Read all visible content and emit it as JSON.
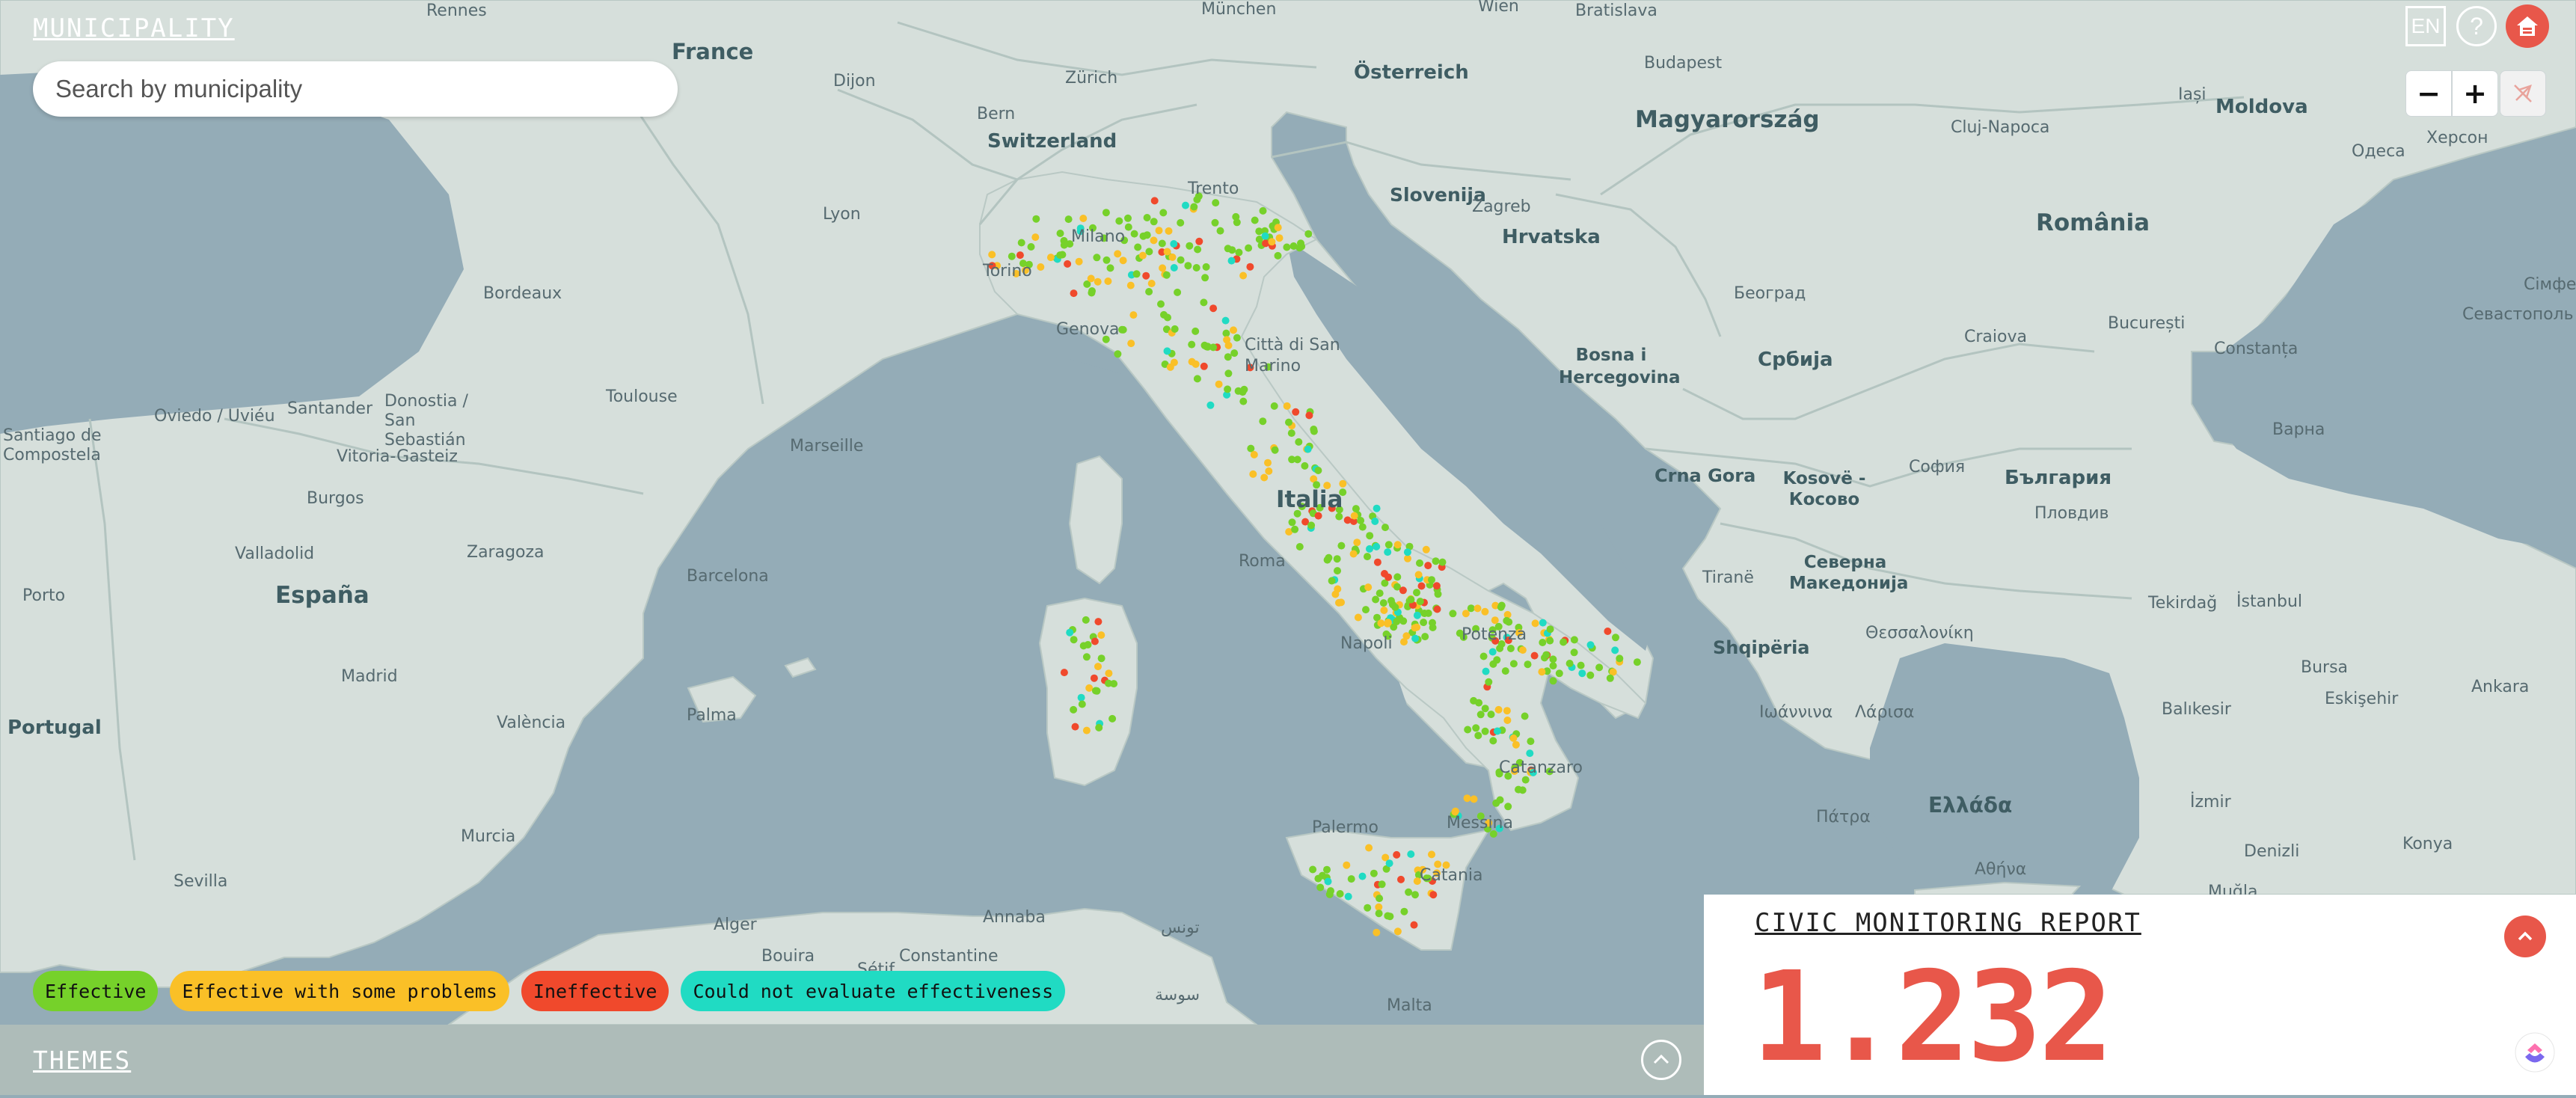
{
  "header": {
    "municipality_title": "MUNICIPALITY",
    "search_placeholder": "Search by municipality",
    "language": "EN",
    "help": "?"
  },
  "zoom": {
    "out": "−",
    "in": "+"
  },
  "legend": [
    {
      "label": "Effective",
      "color": "#76d12a"
    },
    {
      "label": "Effective with some problems",
      "color": "#fac027"
    },
    {
      "label": "Ineffective",
      "color": "#f0492c"
    },
    {
      "label": "Could not evaluate effectiveness",
      "color": "#20dbc3"
    }
  ],
  "themes": {
    "title": "THEMES"
  },
  "report": {
    "title": "CIVIC MONITORING REPORT",
    "count": "1.232",
    "accent": "#e8574a"
  },
  "colors": {
    "sea": "#94acb7",
    "land": "#d6dfdb",
    "panel": "#aebcb9"
  },
  "map_labels": {
    "rennes": "Rennes",
    "france": "France",
    "dijon": "Dijon",
    "munchen": "München",
    "wien": "Wien",
    "bratislava": "Bratislava",
    "zurich": "Zürich",
    "osterreich": "Österreich",
    "budapest": "Budapest",
    "magyarorszag": "Magyarország",
    "bern": "Bern",
    "switzerland": "Switzerland",
    "cluj": "Cluj-Napoca",
    "iasi": "Iași",
    "moldova": "Moldova",
    "odesa": "Одеса",
    "kherson": "Херсон",
    "lyon": "Lyon",
    "trento": "Trento",
    "slovenija": "Slovenija",
    "zagreb": "Zagreb",
    "hrvatska": "Hrvatska",
    "romania": "România",
    "milano": "Milano",
    "torino": "Torino",
    "bordeaux": "Bordeaux",
    "beograd": "Београд",
    "sevastopol": "Севастополь",
    "simferopol": "Сімфе",
    "genova": "Genova",
    "sanmarino": "Città di San Marino",
    "bosna": "Bosna i Hercegovina",
    "srbija": "Србија",
    "craiova": "Craiova",
    "bucuresti": "București",
    "constanta": "Constanța",
    "toulouse": "Toulouse",
    "oviedo": "Oviedo / Uviéu",
    "santander": "Santander",
    "donostia": "Donostia / San Sebastián",
    "santiago": "Santiago de Compostela",
    "vitoria": "Vitoria-Gasteiz",
    "marseille": "Marseille",
    "varna": "Варна",
    "burgos": "Burgos",
    "italia": "Italia",
    "crnagora": "Crna Gora",
    "kosove": "Kosovë - Косово",
    "sofia": "София",
    "bulgaria": "България",
    "plovdiv": "Пловдив",
    "valladolid": "Valladolid",
    "zaragoza": "Zaragoza",
    "barcelona": "Barcelona",
    "roma": "Roma",
    "tirane": "Tiranë",
    "severna": "Северна Македонија",
    "espana": "España",
    "porto": "Porto",
    "potenza": "Potenza",
    "tekirdag": "Tekirdağ",
    "istanbul": "İstanbul",
    "napoli": "Napoli",
    "thessaloniki": "Θεσσαλονίκη",
    "shqiperia": "Shqipëria",
    "bursa": "Bursa",
    "madrid": "Madrid",
    "palma": "Palma",
    "ioannina": "Ιωάννινα",
    "larisa": "Λάρισα",
    "balikesir": "Balıkesir",
    "eskisehir": "Eskişehir",
    "ankara": "Ankara",
    "portugal": "Portugal",
    "valencia": "València",
    "catanzaro": "Catanzaro",
    "izmir": "İzmir",
    "patra": "Πάτρα",
    "ellada": "Ελλάδα",
    "palermo": "Palermo",
    "messina": "Messina",
    "murcia": "Murcia",
    "catania": "Catania",
    "denizli": "Denizli",
    "konya": "Konya",
    "athina": "Αθήνα",
    "mugla": "Muğla",
    "sevilla": "Sevilla",
    "alger": "Alger",
    "annaba": "Annaba",
    "tunis": "تونس",
    "bouira": "Bouira",
    "setif": "Sétif",
    "constantine": "Constantine",
    "sousse": "سوسة",
    "malta": "Malta"
  }
}
